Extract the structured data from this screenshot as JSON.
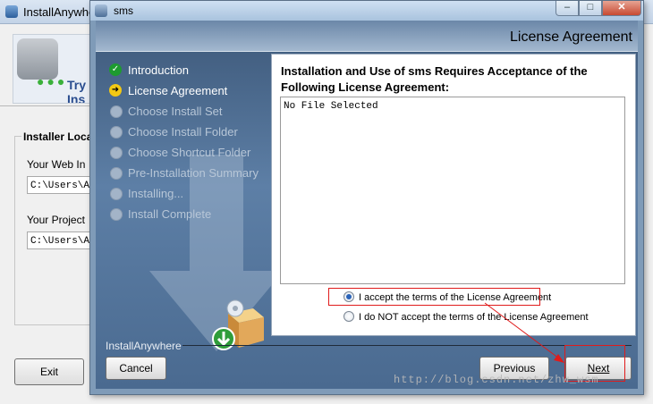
{
  "background_window": {
    "title": "InstallAnywhe",
    "banner_text": "Try Ins",
    "group_label": "Installer Loca",
    "web_label": "Your Web In",
    "web_value": "C:\\Users\\Ad",
    "project_label": "Your Project",
    "project_value": "C:\\Users\\Ad",
    "exit_label": "Exit"
  },
  "dialog": {
    "title": "sms",
    "header_title": "License Agreement",
    "steps": [
      {
        "label": "Introduction",
        "state": "done"
      },
      {
        "label": "License Agreement",
        "state": "current"
      },
      {
        "label": "Choose Install Set",
        "state": "pending"
      },
      {
        "label": "Choose Install Folder",
        "state": "pending"
      },
      {
        "label": "Choose Shortcut Folder",
        "state": "pending"
      },
      {
        "label": "Pre-Installation Summary",
        "state": "pending"
      },
      {
        "label": "Installing...",
        "state": "pending"
      },
      {
        "label": "Install Complete",
        "state": "pending"
      }
    ],
    "panel_heading": "Installation and Use of sms Requires Acceptance of the Following License Agreement:",
    "license_text": "No File Selected",
    "accept_label": "I accept the terms of the License Agreement",
    "decline_label": "I do NOT accept the terms of the License Agreement",
    "accept_selected": true,
    "brand_label": "InstallAnywhere",
    "cancel_label": "Cancel",
    "previous_label": "Previous",
    "next_label": "Next"
  },
  "watermark": "http://blog.csdn.net/zhw_wsm",
  "colors": {
    "highlight": "#e01b1b",
    "done_icon": "#1d9b2f",
    "current_icon": "#f3c813"
  }
}
